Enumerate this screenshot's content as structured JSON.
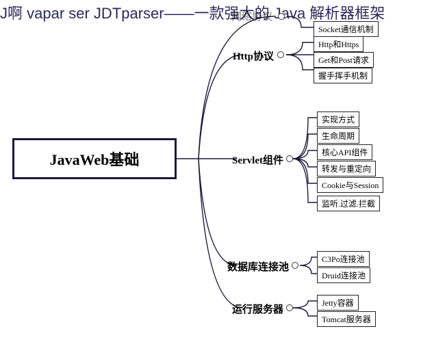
{
  "title": "J啊 vapar ser JDTparser——一款强大的 Java 解析器框架",
  "root": "JavaWeb基础",
  "branches": [
    {
      "label": "网络协议",
      "leaves": [
        "Socket通信机制"
      ]
    },
    {
      "label": "Http协议",
      "leaves": [
        "Http和Https",
        "Get和Post请求",
        "握手挥手机制"
      ]
    },
    {
      "label": "Servlet组件",
      "leaves": [
        "实现方式",
        "生命周期",
        "核心API组件",
        "转发与重定向",
        "Cookie与Session",
        "监听.过滤.拦截"
      ]
    },
    {
      "label": "数据库连接池",
      "leaves": [
        "C3Po连接池",
        "Druid连接池"
      ]
    },
    {
      "label": "运行服务器",
      "leaves": [
        "Jetty容器",
        "Tomcat服务器"
      ]
    }
  ]
}
